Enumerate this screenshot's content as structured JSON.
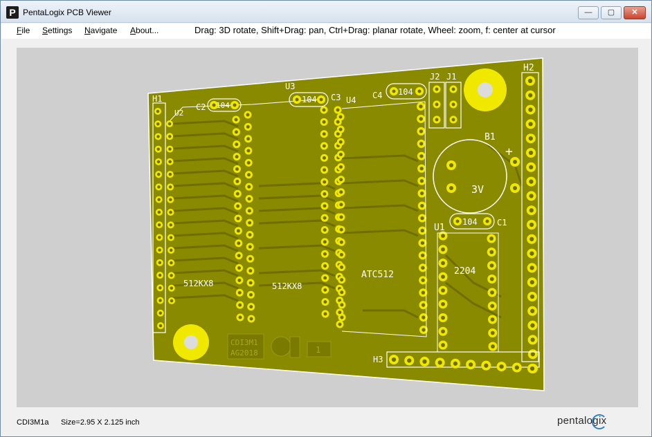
{
  "window": {
    "title": "PentaLogix PCB Viewer",
    "icon_letter": "P",
    "controls": {
      "minimize": "—",
      "maximize": "▢",
      "close": "✕"
    }
  },
  "menu": {
    "items": [
      {
        "label": "File",
        "key": "F",
        "rest": "ile"
      },
      {
        "label": "Settings",
        "key": "S",
        "rest": "ettings"
      },
      {
        "label": "Navigate",
        "key": "N",
        "rest": "avigate"
      },
      {
        "label": "About...",
        "key": "A",
        "rest": "bout..."
      }
    ]
  },
  "hint": "Drag: 3D rotate, Shift+Drag: pan, Ctrl+Drag: planar rotate, Wheel: zoom, f: center at cursor",
  "board": {
    "colors": {
      "board": "#8a8a00",
      "pad": "#f1e800",
      "silk": "#ffffff",
      "viewport": "#cfcfcf"
    },
    "labels": {
      "H1": "H1",
      "H2": "H2",
      "H3": "H3",
      "U1": "U1",
      "U2": "U2",
      "U3": "U3",
      "U4": "U4",
      "C1": "C1",
      "C2": "C2",
      "C3": "C3",
      "C4": "C4",
      "J1": "J1",
      "J2": "J2",
      "B1": "B1",
      "cap_value": "104",
      "battery_voltage": "3V",
      "battery_plus": "+",
      "chip_512a": "512KX8",
      "chip_512b": "512KX8",
      "chip_atc": "ATC512",
      "chip_2204": "2204",
      "board_id": "CDI3M1",
      "board_date": "AG2018",
      "box_mark": "1"
    }
  },
  "status": {
    "design": "CDI3M1a",
    "size": "Size=2.95 X 2.125 inch",
    "brand": "pentalogix"
  }
}
